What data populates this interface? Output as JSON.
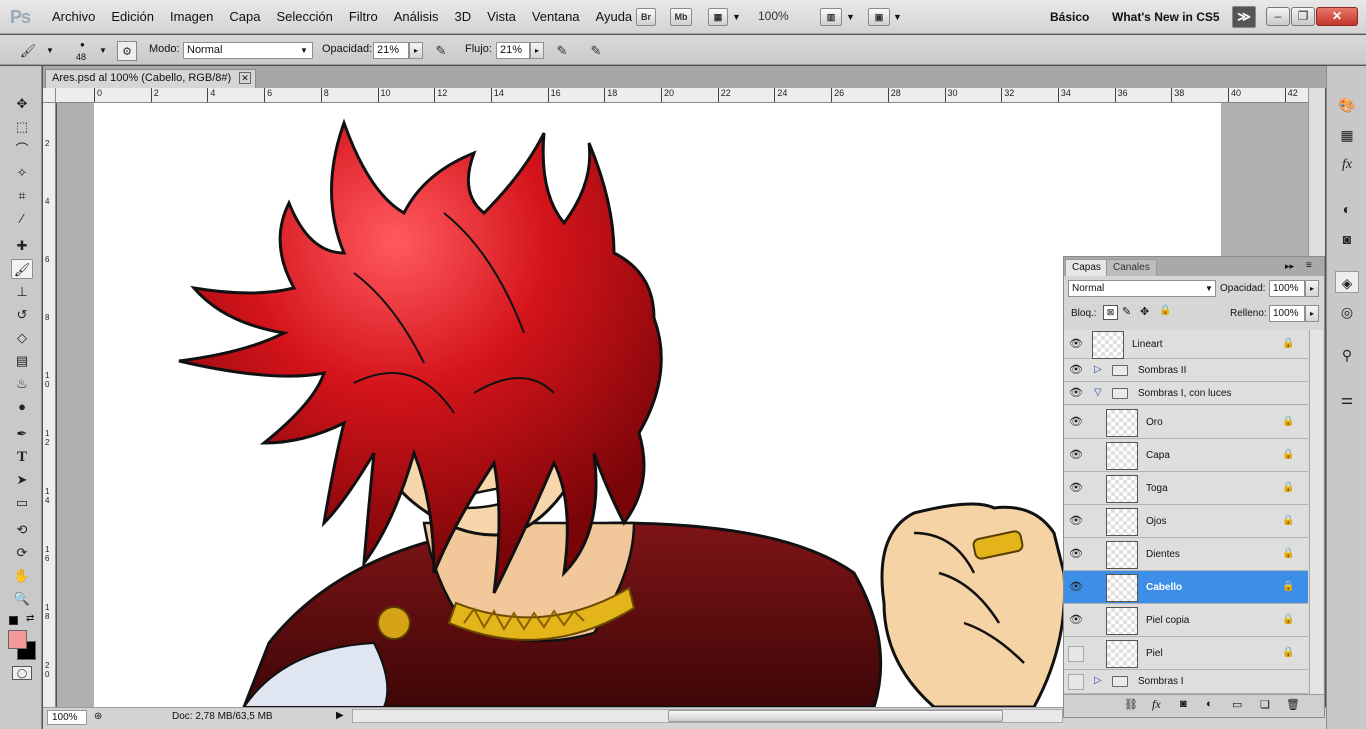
{
  "app": {
    "logo": "Ps"
  },
  "menu": [
    "Archivo",
    "Edición",
    "Imagen",
    "Capa",
    "Selección",
    "Filtro",
    "Análisis",
    "3D",
    "Vista",
    "Ventana",
    "Ayuda"
  ],
  "appbar": {
    "br": "Br",
    "mb": "Mb",
    "zoom": "100%",
    "workspace_basic": "Básico",
    "whats_new": "What's New in CS5",
    "overflow": "≫"
  },
  "options": {
    "brush_size": "48",
    "mode_label": "Modo:",
    "mode_value": "Normal",
    "opacity_label": "Opacidad:",
    "opacity_value": "21%",
    "flow_label": "Flujo:",
    "flow_value": "21%"
  },
  "document": {
    "tab_title": "Ares.psd al 100% (Cabello, RGB/8#)",
    "close": "✕"
  },
  "ruler_h": [
    "0",
    "2",
    "4",
    "6",
    "8",
    "10",
    "12",
    "14",
    "16",
    "18",
    "20",
    "22",
    "24",
    "26",
    "28",
    "30",
    "32",
    "34",
    "36",
    "38",
    "40",
    "42"
  ],
  "ruler_v": [
    "2",
    "4",
    "6",
    "8",
    "1\n0",
    "1\n2",
    "1\n4",
    "1\n6",
    "1\n8",
    "2\n0"
  ],
  "status": {
    "zoom": "100%",
    "doc": "Doc: 2,78 MB/63,5 MB"
  },
  "colors": {
    "foreground": "#f59a9a",
    "background": "#000000",
    "selection": "#3d8ee6",
    "hair": "#d4141b",
    "skin": "#f6d3a4",
    "cape": "#6e0d10",
    "gold": "#e3b51b"
  },
  "layers_panel": {
    "tab_layers": "Capas",
    "tab_channels": "Canales",
    "blend_mode": "Normal",
    "opacity_label": "Opacidad:",
    "opacity_value": "100%",
    "lock_label": "Bloq.:",
    "fill_label": "Relleno:",
    "fill_value": "100%",
    "layers": [
      {
        "name": "Lineart",
        "type": "layer",
        "visible": true
      },
      {
        "name": "Sombras II",
        "type": "group",
        "visible": true
      },
      {
        "name": "Sombras I, con luces",
        "type": "group-open",
        "visible": true
      },
      {
        "name": "Oro",
        "type": "layer",
        "visible": true
      },
      {
        "name": "Capa",
        "type": "layer",
        "visible": true
      },
      {
        "name": "Toga",
        "type": "layer",
        "visible": true
      },
      {
        "name": "Ojos",
        "type": "layer",
        "visible": true
      },
      {
        "name": "Dientes",
        "type": "layer",
        "visible": true
      },
      {
        "name": "Cabello",
        "type": "layer",
        "visible": true,
        "selected": true
      },
      {
        "name": "Piel copia",
        "type": "layer",
        "visible": true
      },
      {
        "name": "Piel",
        "type": "layer",
        "visible": false
      },
      {
        "name": "Sombras I",
        "type": "group",
        "visible": false
      }
    ]
  },
  "icons": {
    "eye": "eye-icon",
    "lock": "lock-icon",
    "folder": "folder-icon"
  }
}
